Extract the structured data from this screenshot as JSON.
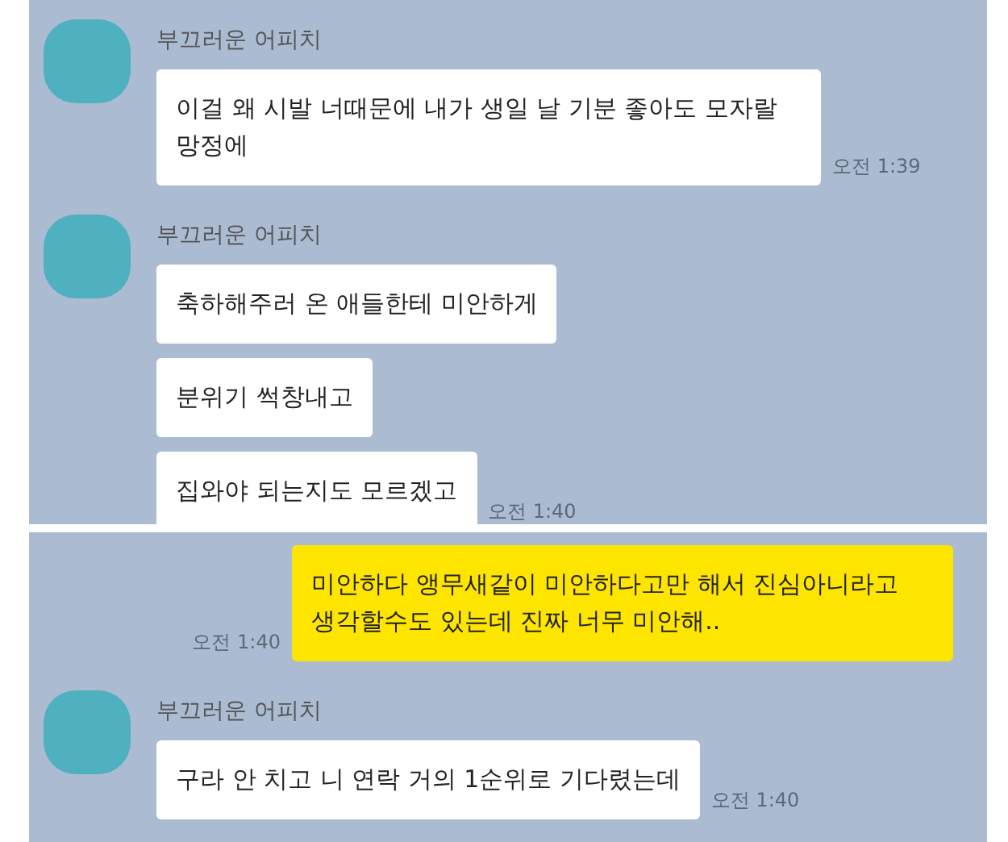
{
  "panels": [
    {
      "items": [
        {
          "kind": "received",
          "sender": "부끄러운 어피치",
          "messages": [
            {
              "text": "이걸 왜 시발 너때문에 내가 생일 날 기분 좋아도 모자랄 망정에",
              "time": "오전 1:39"
            }
          ]
        },
        {
          "kind": "received",
          "sender": "부끄러운 어피치",
          "messages": [
            {
              "text": "축하해주러 온 애들한테 미안하게"
            },
            {
              "text": "분위기 썩창내고"
            },
            {
              "text": "집와야 되는지도 모르겠고",
              "time": "오전 1:40"
            }
          ]
        }
      ]
    },
    {
      "items": [
        {
          "kind": "sent",
          "messages": [
            {
              "text": "미안하다 앵무새같이 미안하다고만 해서 진심아니라고 생각할수도 있는데 진짜 너무 미안해..",
              "time": "오전 1:40"
            }
          ]
        },
        {
          "kind": "received",
          "sender": "부끄러운 어피치",
          "messages": [
            {
              "text": "구라 안 치고 니 연락 거의 1순위로 기다렸는데",
              "time": "오전 1:40"
            }
          ]
        }
      ]
    }
  ]
}
